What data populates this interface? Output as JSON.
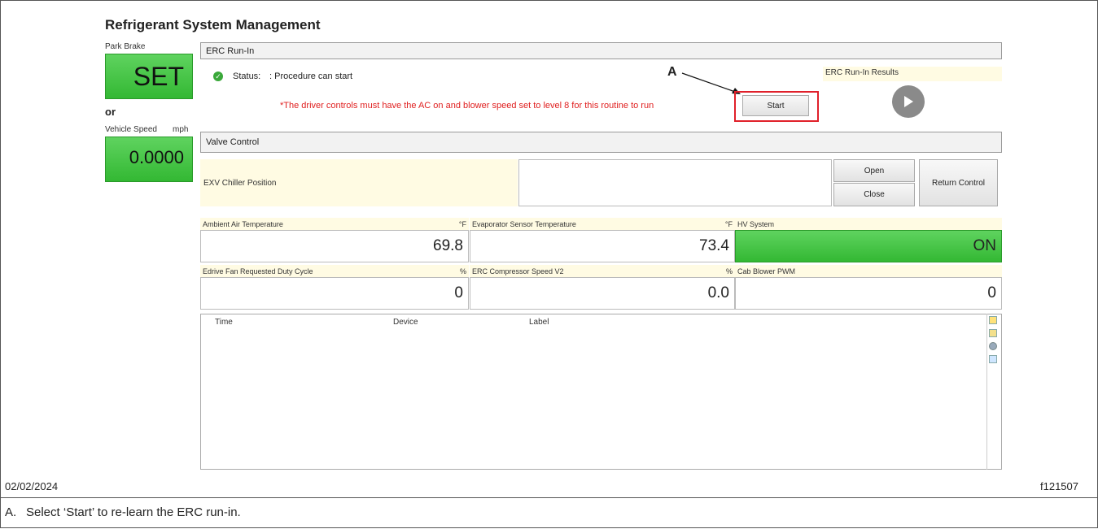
{
  "app": {
    "title": "Refrigerant System Management"
  },
  "left": {
    "park_brake_label": "Park Brake",
    "park_brake_value": "SET",
    "or_label": "or",
    "speed_label": "Vehicle Speed",
    "speed_unit": "mph",
    "speed_value": "0.0000"
  },
  "erc": {
    "header": "ERC Run-In",
    "status_label": "Status:",
    "status_text": ": Procedure can start",
    "warning": "*The driver controls must have the AC on and blower speed set to level 8 for this routine to run",
    "start_label": "Start",
    "results_label": "ERC Run-In Results"
  },
  "valve": {
    "header": "Valve Control",
    "exv_label": "EXV Chiller Position",
    "open_label": "Open",
    "close_label": "Close",
    "return_label": "Return Control"
  },
  "readings": [
    {
      "label": "Ambient Air Temperature",
      "unit": "°F",
      "value": "69.8"
    },
    {
      "label": "Evaporator Sensor Temperature",
      "unit": "°F",
      "value": "73.4"
    },
    {
      "label": "HV System",
      "unit": "",
      "value": "ON"
    },
    {
      "label": "Edrive Fan Requested Duty Cycle",
      "unit": "%",
      "value": "0"
    },
    {
      "label": "ERC Compressor Speed V2",
      "unit": "%",
      "value": "0.0"
    },
    {
      "label": "Cab Blower PWM",
      "unit": "",
      "value": "0"
    }
  ],
  "log": {
    "columns": [
      "Time",
      "Device",
      "Label"
    ]
  },
  "annotation": {
    "callout": "A"
  },
  "footer": {
    "date": "02/02/2024",
    "figure_id": "f121507",
    "caption_letter": "A.",
    "caption_text": "Select ‘Start’ to re-learn the ERC run-in."
  },
  "colors": {
    "accent_green": "#3cc43c",
    "warning_red": "#e02020",
    "highlight_red": "#e0202a",
    "panel_yellow": "#fffbe3"
  }
}
